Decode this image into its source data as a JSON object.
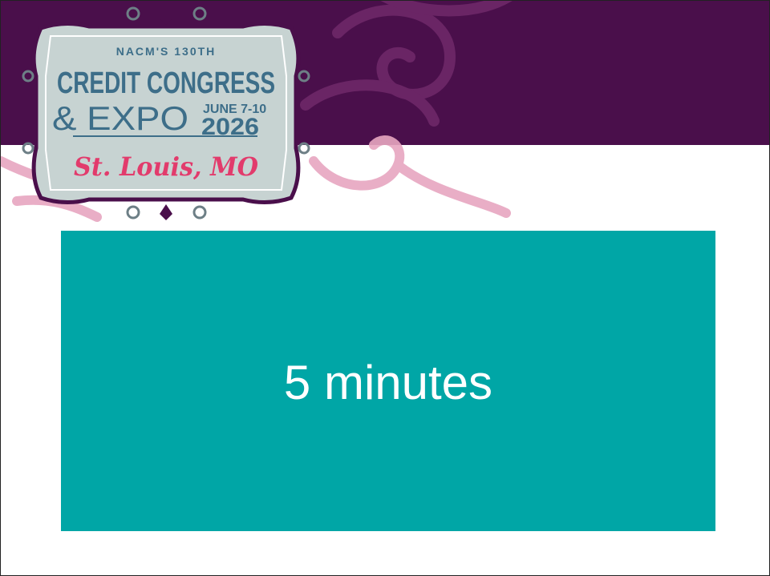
{
  "colors": {
    "banner_purple": "#4a0f4b",
    "swirl_pink": "#e7a6c0",
    "swirl_magenta": "#6a2565",
    "timer_teal": "#00a6a6",
    "logo_frame": "#c7d3d2",
    "logo_text_blue": "#3d6e89",
    "logo_text_pink": "#e23b6c"
  },
  "logo": {
    "kicker": "NACM'S 130TH",
    "title_line1": "CREDIT CONGRESS",
    "title_line2": "& EXPO",
    "dates": "JUNE 7-10",
    "year": "2026",
    "location": "St. Louis, MO"
  },
  "timer": {
    "label": "5 minutes"
  }
}
